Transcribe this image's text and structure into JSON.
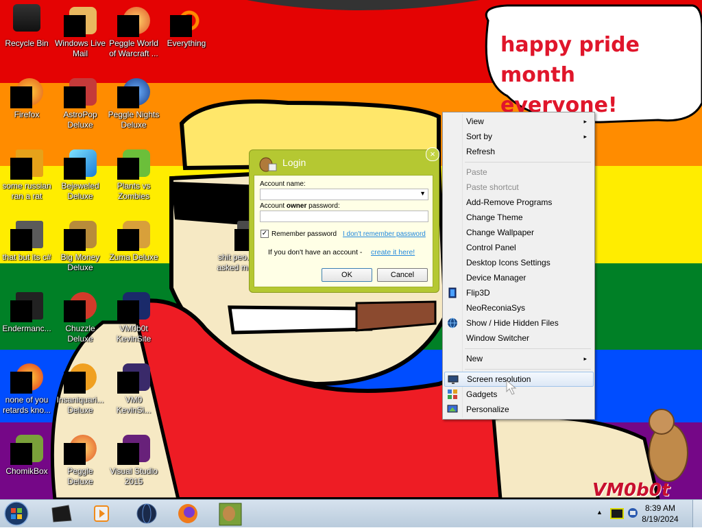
{
  "wallpaper": {
    "stripes": [
      "#e40303",
      "#ff8c00",
      "#ffed00",
      "#008026",
      "#004dff",
      "#750787"
    ],
    "bubble_line1": "happy pride month",
    "bubble_line2": "everyone!",
    "brand": "VM0b0t"
  },
  "desktop": {
    "icons": [
      {
        "label": "Recycle Bin",
        "icon": "recycle-bin-icon"
      },
      {
        "label": "Windows Live Mail",
        "icon": "mail-icon"
      },
      {
        "label": "Peggle World of Warcraft ...",
        "icon": "peggle-icon"
      },
      {
        "label": "Everything",
        "icon": "search-icon"
      },
      {
        "label": "Firefox",
        "icon": "firefox-icon"
      },
      {
        "label": "AstroPop Deluxe",
        "icon": "game-icon"
      },
      {
        "label": "Peggle Nights Deluxe",
        "icon": "peggle-icon"
      },
      {
        "label": "some russian ran a rat",
        "icon": "file-icon"
      },
      {
        "label": "Bejeweled Deluxe",
        "icon": "gem-icon"
      },
      {
        "label": "Plants vs Zombies",
        "icon": "plant-icon"
      },
      {
        "label": "that but its c#",
        "icon": "file-icon"
      },
      {
        "label": "Big Money Deluxe",
        "icon": "money-icon"
      },
      {
        "label": "Zuma Deluxe",
        "icon": "zuma-icon"
      },
      {
        "label": "shit peo... asked m...",
        "icon": "file-icon"
      },
      {
        "label": "Endermanc...",
        "icon": "app-icon"
      },
      {
        "label": "Chuzzle Deluxe",
        "icon": "chuzzle-icon"
      },
      {
        "label": "VM0b0t KevinSite",
        "icon": "app-icon"
      },
      {
        "label": "none of you retards kno...",
        "icon": "app-icon"
      },
      {
        "label": "Insaniquari... Deluxe",
        "icon": "fish-icon"
      },
      {
        "label": "VM0 KevinSi...",
        "icon": "app-icon"
      },
      {
        "label": "ChomikBox",
        "icon": "hamster-icon"
      },
      {
        "label": "Peggle Deluxe",
        "icon": "peggle-icon"
      },
      {
        "label": "Visual Studio 2015",
        "icon": "visual-studio-icon"
      }
    ]
  },
  "login": {
    "title": "Login",
    "close": "×",
    "account_name_label": "Account name:",
    "account_name_value": "",
    "password_label_prefix": "Account ",
    "password_label_bold": "owner",
    "password_label_suffix": " password:",
    "password_value": "",
    "remember_label": "Remember password",
    "remember_checked": "✓",
    "forgot_link": "I don't remember password",
    "no_account_text": "If you don't have an account - ",
    "create_link": "create it here!",
    "ok": "OK",
    "cancel": "Cancel"
  },
  "context_menu": {
    "items": [
      {
        "label": "View",
        "submenu": "▸"
      },
      {
        "label": "Sort by",
        "submenu": "▸"
      },
      {
        "label": "Refresh"
      },
      {
        "label": "Paste",
        "disabled": true
      },
      {
        "label": "Paste shortcut",
        "disabled": true
      },
      {
        "label": "Add-Remove Programs"
      },
      {
        "label": "Change Theme"
      },
      {
        "label": "Change Wallpaper"
      },
      {
        "label": "Control Panel"
      },
      {
        "label": "Desktop Icons Settings"
      },
      {
        "label": "Device Manager"
      },
      {
        "label": "Flip3D",
        "icon": "flip3d-icon"
      },
      {
        "label": "NeoReconiaSys"
      },
      {
        "label": "Show / Hide Hidden Files",
        "icon": "globe-icon"
      },
      {
        "label": "Window Switcher"
      },
      {
        "label": "New",
        "submenu": "▸"
      },
      {
        "label": "Screen resolution",
        "icon": "monitor-icon",
        "hover": true
      },
      {
        "label": "Gadgets",
        "icon": "gadgets-icon"
      },
      {
        "label": "Personalize",
        "icon": "personalize-icon"
      }
    ]
  },
  "taskbar": {
    "pinned": [
      "terminal-icon",
      "media-player-icon",
      "globe-icon",
      "firefox-icon",
      "chomikbox-icon"
    ],
    "tray_arrow": "▲",
    "time": "8:39 AM",
    "date": "8/19/2024"
  }
}
